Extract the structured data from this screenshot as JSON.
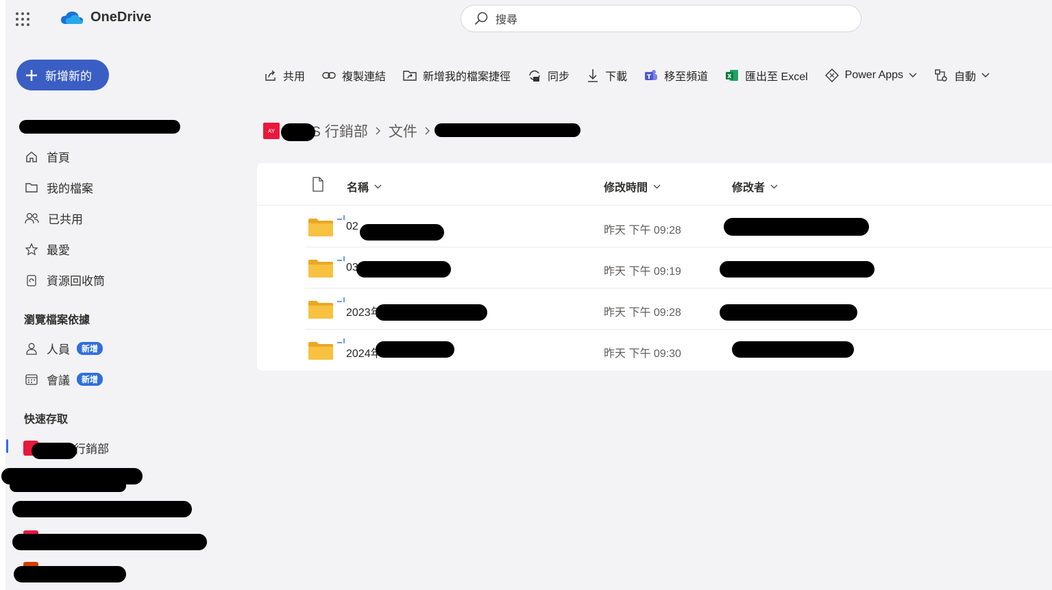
{
  "app": {
    "name": "OneDrive"
  },
  "search": {
    "placeholder": "搜尋"
  },
  "new_button": {
    "label": "新增新的"
  },
  "toolbar": {
    "share": "共用",
    "copy_link": "複製連結",
    "add_shortcut": "新增我的檔案捷徑",
    "sync": "同步",
    "download": "下載",
    "move_to_channel": "移至頻道",
    "export_excel": "匯出至 Excel",
    "power_apps": "Power Apps",
    "automate": "自動"
  },
  "sidebar": {
    "items": [
      {
        "label": "首頁",
        "icon": "home-icon"
      },
      {
        "label": "我的檔案",
        "icon": "folder-icon"
      },
      {
        "label": "已共用",
        "icon": "people-icon"
      },
      {
        "label": "最愛",
        "icon": "star-icon"
      },
      {
        "label": "資源回收筒",
        "icon": "recycle-bin-icon"
      }
    ],
    "browse_heading": "瀏覽檔案依據",
    "browse": [
      {
        "label": "人員",
        "badge": "新增",
        "icon": "person-icon"
      },
      {
        "label": "會議",
        "badge": "新增",
        "icon": "calendar-icon"
      }
    ],
    "quick_heading": "快速存取",
    "quick": [
      {
        "label": "行銷部",
        "logo_text": "AY"
      }
    ]
  },
  "breadcrumb": {
    "logo_text": "AY",
    "partial_visible": "S 行銷部",
    "items": [
      "行銷部",
      "文件"
    ]
  },
  "columns": {
    "name": "名稱",
    "modified": "修改時間",
    "modified_by": "修改者"
  },
  "files": [
    {
      "name_prefix": "02",
      "modified": "昨天 下午 09:28"
    },
    {
      "name_prefix": "03",
      "modified": "昨天 下午 09:19"
    },
    {
      "name_prefix": "2023年",
      "modified": "昨天 下午 09:28"
    },
    {
      "name_prefix": "2024年",
      "modified": "昨天 下午 09:30"
    }
  ],
  "colors": {
    "accent": "#3a5ec4",
    "site_logo": "#e8193c",
    "folder": "#f8c140"
  }
}
